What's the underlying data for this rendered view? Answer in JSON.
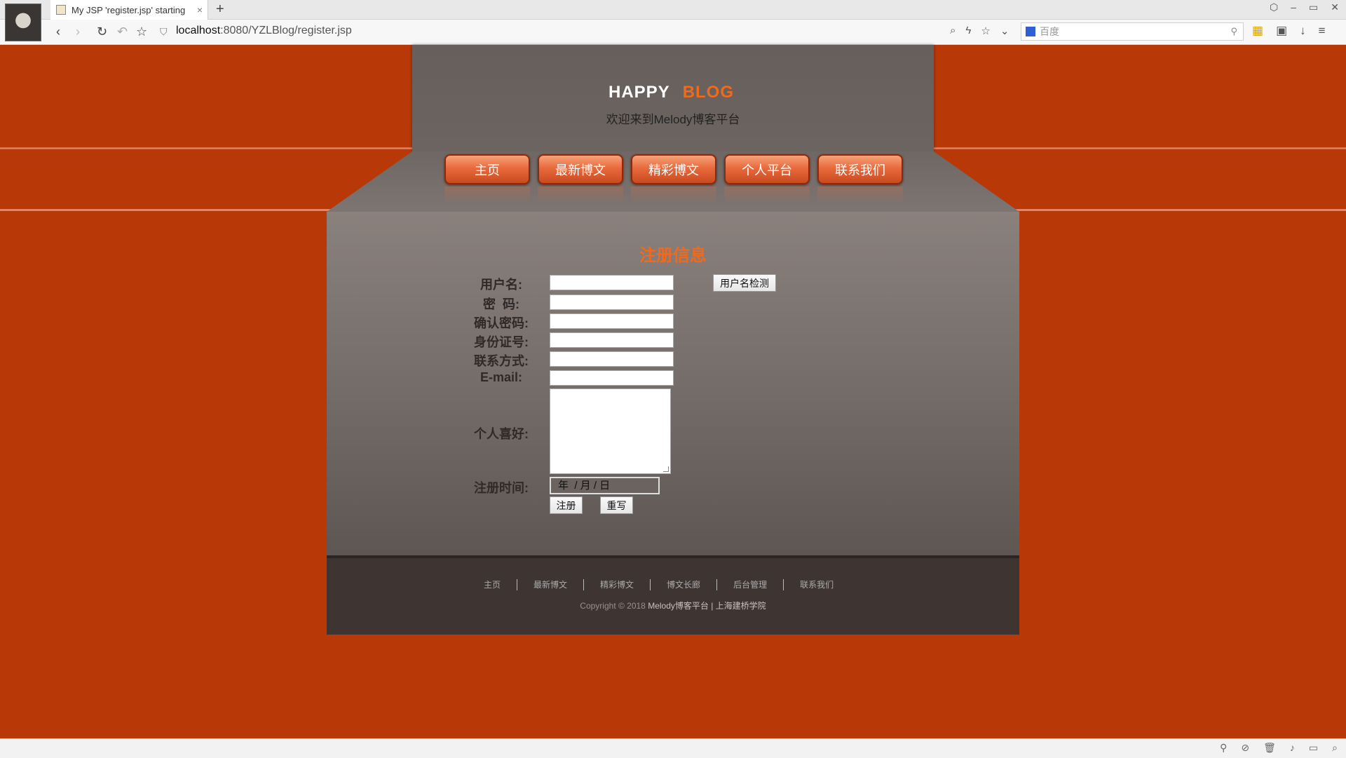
{
  "browser": {
    "tab_title": "My JSP 'register.jsp' starting",
    "tab_close": "×",
    "new_tab": "+",
    "url_host": "localhost",
    "url_path": ":8080/YZLBlog/register.jsp",
    "search_placeholder": "百度"
  },
  "site": {
    "logo_happy": "HAPPY",
    "logo_blog": "BLOG",
    "tagline": "欢迎来到Melody博客平台"
  },
  "menu": [
    "主页",
    "最新博文",
    "精彩博文",
    "个人平台",
    "联系我们"
  ],
  "form": {
    "title": "注册信息",
    "username_label": "用户名:",
    "password_label": "密  码:",
    "confirm_label": "确认密码:",
    "idcard_label": "身份证号:",
    "contact_label": "联系方式:",
    "email_label": "E-mail:",
    "hobby_label": "个人喜好:",
    "date_label": "注册时间:",
    "date_placeholder": "年  / 月 / 日",
    "check_button": "用户名检测",
    "submit_button": "注册",
    "reset_button": "重写"
  },
  "footer": {
    "links": [
      "主页",
      "最新博文",
      "精彩博文",
      "博文长廊",
      "后台管理",
      "联系我们"
    ],
    "copyright_prefix": "Copyright © 2018 ",
    "copyright_highlight": "Melody博客平台 | 上海建桥学院"
  },
  "colors": {
    "background": "#b83808",
    "accent": "#f06a1e"
  }
}
